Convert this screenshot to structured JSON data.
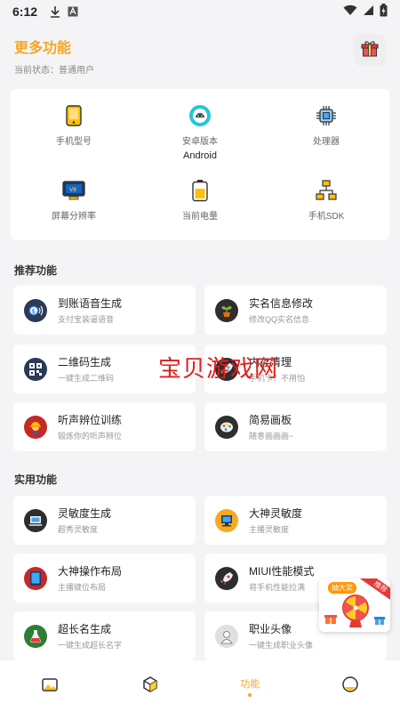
{
  "status_bar": {
    "time": "6:12"
  },
  "header": {
    "title": "更多功能",
    "subtitle": "当前状态：普通用户"
  },
  "device_info": [
    {
      "label": "手机型号",
      "value": "",
      "icon": "phone-icon"
    },
    {
      "label": "安卓版本",
      "value": "Android",
      "icon": "android-icon"
    },
    {
      "label": "处理器",
      "value": "",
      "icon": "cpu-icon"
    },
    {
      "label": "屏幕分辨率",
      "value": "",
      "icon": "monitor-icon"
    },
    {
      "label": "当前电量",
      "value": "",
      "icon": "battery-icon"
    },
    {
      "label": "手机SDK",
      "value": "",
      "icon": "sdk-icon"
    }
  ],
  "sections": {
    "recommended": "推荐功能",
    "practical": "实用功能"
  },
  "recommended_items": [
    {
      "title": "到账语音生成",
      "desc": "支付宝装逼语音",
      "icon": "money-voice-icon"
    },
    {
      "title": "实名信息修改",
      "desc": "修改QQ实名信息",
      "icon": "plant-icon"
    },
    {
      "title": "二维码生成",
      "desc": "一键生成二维码",
      "icon": "qrcode-icon"
    },
    {
      "title": "内存清理",
      "desc": "手机卡？不用怕",
      "icon": "rocket-icon"
    },
    {
      "title": "听声辨位训练",
      "desc": "锻炼你的听声辨位",
      "icon": "worker-icon"
    },
    {
      "title": "简易画板",
      "desc": "随意画画画~",
      "icon": "palette-icon"
    }
  ],
  "practical_items": [
    {
      "title": "灵敏度生成",
      "desc": "超秀灵敏度",
      "icon": "laptop-icon"
    },
    {
      "title": "大神灵敏度",
      "desc": "主播灵敏度",
      "icon": "monitor-user-icon"
    },
    {
      "title": "大神操作布局",
      "desc": "主播键位布局",
      "icon": "tablet-icon"
    },
    {
      "title": "MIUI性能模式",
      "desc": "将手机性能拉满",
      "icon": "rocket-icon"
    },
    {
      "title": "超长名生成",
      "desc": "一键生成超长名字",
      "icon": "flask-icon"
    },
    {
      "title": "职业头像",
      "desc": "一键生成职业头像",
      "icon": "avatar-icon"
    }
  ],
  "watermark": "宝贝游戏网",
  "float_ad": {
    "title": "抽大奖",
    "tag": "推荐"
  },
  "bottom_nav": [
    {
      "label": "",
      "icon": "home-icon"
    },
    {
      "label": "",
      "icon": "box-icon"
    },
    {
      "label": "功能",
      "icon": "",
      "active": true
    },
    {
      "label": "",
      "icon": "profile-icon"
    }
  ],
  "colors": {
    "accent": "#f5a623",
    "background": "#f4f4f6",
    "card": "#ffffff"
  }
}
